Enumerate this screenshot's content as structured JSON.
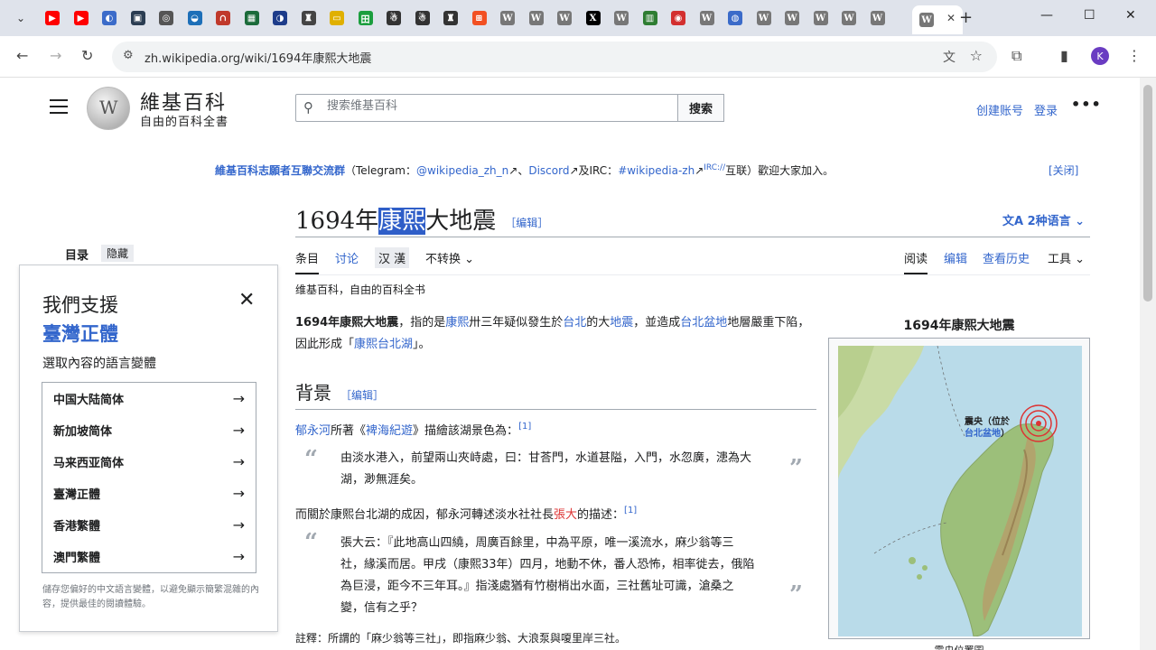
{
  "browser": {
    "tab_close": "✕",
    "url": "zh.wikipedia.org/wiki/1694年康熙大地震",
    "profile_initial": "K",
    "tab_icons": [
      {
        "color": "#ff0000",
        "glyph": "▶"
      },
      {
        "color": "#ff0000",
        "glyph": "▶"
      },
      {
        "color": "#3b6bc9",
        "glyph": "◐"
      },
      {
        "color": "#2b3d52",
        "glyph": "▣"
      },
      {
        "color": "#555555",
        "glyph": "◎"
      },
      {
        "color": "#1d6fb8",
        "glyph": "◒"
      },
      {
        "color": "#c0392b",
        "glyph": "∩"
      },
      {
        "color": "#1b6b3a",
        "glyph": "▦"
      },
      {
        "color": "#1d3c8a",
        "glyph": "◑"
      },
      {
        "color": "#444444",
        "glyph": "♜"
      },
      {
        "color": "#e0b000",
        "glyph": "▭"
      },
      {
        "color": "#1b9e3e",
        "glyph": "田"
      },
      {
        "color": "#333333",
        "glyph": "☃"
      },
      {
        "color": "#333333",
        "glyph": "☃"
      },
      {
        "color": "#333333",
        "glyph": "♜"
      },
      {
        "color": "#f25022",
        "glyph": "⊞"
      },
      {
        "color": "#777777",
        "glyph": "W"
      },
      {
        "color": "#777777",
        "glyph": "W"
      },
      {
        "color": "#777777",
        "glyph": "W"
      },
      {
        "color": "#000000",
        "glyph": "X"
      },
      {
        "color": "#777777",
        "glyph": "W"
      },
      {
        "color": "#2e7d32",
        "glyph": "▥"
      },
      {
        "color": "#d32f2f",
        "glyph": "◉"
      },
      {
        "color": "#777777",
        "glyph": "W"
      },
      {
        "color": "#3b6bc9",
        "glyph": "◍"
      },
      {
        "color": "#777777",
        "glyph": "W"
      },
      {
        "color": "#777777",
        "glyph": "W"
      },
      {
        "color": "#777777",
        "glyph": "W"
      },
      {
        "color": "#777777",
        "glyph": "W"
      },
      {
        "color": "#777777",
        "glyph": "W"
      }
    ],
    "active_tab_glyph": "W"
  },
  "header": {
    "wordmark": "維基百科",
    "tagline": "自由的百科全書",
    "search_placeholder": "搜索维基百科",
    "search_button": "搜索",
    "create_account": "创建账号",
    "login": "登录"
  },
  "notice": {
    "part1": "維基百科志願者互聯交流群",
    "part2": "（Telegram：",
    "part3": "@wikipedia_zh_n",
    "part4": "、",
    "part5": "Discord",
    "part6": "及IRC：",
    "part7": "#wikipedia-zh",
    "part8": "IRC://",
    "part9": "互联）歡迎大家加入。",
    "close": "[关闭]"
  },
  "article": {
    "title_pre": "1694年",
    "title_sel": "康熙",
    "title_post": "大地震",
    "edit": "［编辑］",
    "languages": "2种语言",
    "tabs": {
      "article": "条目",
      "talk": "讨论",
      "variant": "汉 漢",
      "convert": "不转换",
      "read": "阅读",
      "edit": "编辑",
      "history": "查看历史",
      "tools": "工具"
    },
    "site_sub": "维基百科，自由的百科全书",
    "lead": {
      "b": "1694年康熙大地震",
      "t1": "，指的是",
      "l1": "康熙",
      "t2": "卅三年疑似發生於",
      "l2": "台北",
      "t3": "的大",
      "l3": "地震",
      "t4": "，並造成",
      "l4": "台北盆地",
      "t5": "地層嚴重下陷，因此形成「",
      "l5": "康熙台北湖",
      "t6": "」。"
    },
    "section_bg": "背景",
    "p2": {
      "l1": "郁永河",
      "t1": "所著《",
      "l2": "裨海紀遊",
      "t2": "》描繪該湖景色為：",
      "ref": "[1]"
    },
    "quote1": "由淡水港入，前望兩山夾峙處，曰：甘荅門，水道甚隘，入門，水忽廣，漶為大湖，渺無涯矣。",
    "p3": {
      "t1": "而關於康熙台北湖的成因，郁永河轉述淡水社社長",
      "r1": "張大",
      "t2": "的描述：",
      "ref": "[1]"
    },
    "quote2": "張大云：『此地高山四繞，周廣百餘里，中為平原，唯一溪流水，麻少翁等三社，緣溪而居。甲戌（康熙33年）四月，地動不休，番人恐怖，相率徙去，俄陷為巨浸，距今不三年耳。』指淺處猶有竹樹梢出水面，三社舊址可識，滄桑之變，信有之乎？",
    "footnote": "註釋：所謂的「麻少翁等三社」，即指麻少翁、大浪泵與嗄里岸三社。",
    "quote_open": "“",
    "quote_close": "”"
  },
  "toc": {
    "label": "目录",
    "hide": "隐藏"
  },
  "lang_panel": {
    "line1": "我們支援",
    "line2": "臺灣正體",
    "line3": "選取內容的語言變體",
    "items": [
      "中国大陆简体",
      "新加坡简体",
      "马来西亚简体",
      "臺灣正體",
      "香港繁體",
      "澳門繁體"
    ],
    "note": "儲存您偏好的中文語言變體，以避免顯示簡繁混雜的內容，提供最佳的閱讀體驗。"
  },
  "infobox": {
    "title": "1694年康熙大地震",
    "epicenter_label": "震央（位於",
    "epicenter_link": "台北盆地",
    "epicenter_close": "）",
    "caption": "震央位置圖"
  }
}
